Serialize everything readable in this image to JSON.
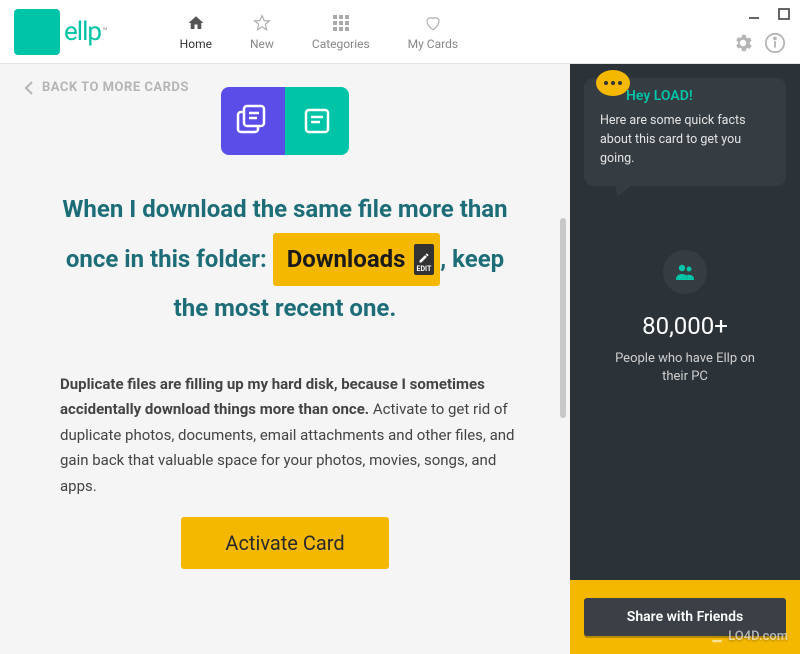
{
  "brand": {
    "name": "ellp"
  },
  "nav": {
    "home": "Home",
    "new": "New",
    "categories": "Categories",
    "mycards": "My Cards"
  },
  "main": {
    "back_label": "BACK TO MORE CARDS",
    "headline_part1": "When I download the same file more than once in this folder:",
    "folder_name": "Downloads",
    "edit_label": "EDIT",
    "headline_part2": ", keep the most recent one.",
    "description_bold": "Duplicate files are filling up my hard disk, because I sometimes accidentally download things more than once.",
    "description_rest": " Activate to get rid of duplicate photos, documents, email attachments and other files, and gain back that valuable space for your photos, movies, songs, and apps.",
    "activate_label": "Activate Card"
  },
  "sidebar": {
    "greeting": "Hey LOAD!",
    "greeting_body": "Here are some quick facts about this card to get you going.",
    "stat_number": "80,000+",
    "stat_label": "People who have Ellp on their PC",
    "share_label": "Share with Friends"
  },
  "watermark": "LO4D.com"
}
